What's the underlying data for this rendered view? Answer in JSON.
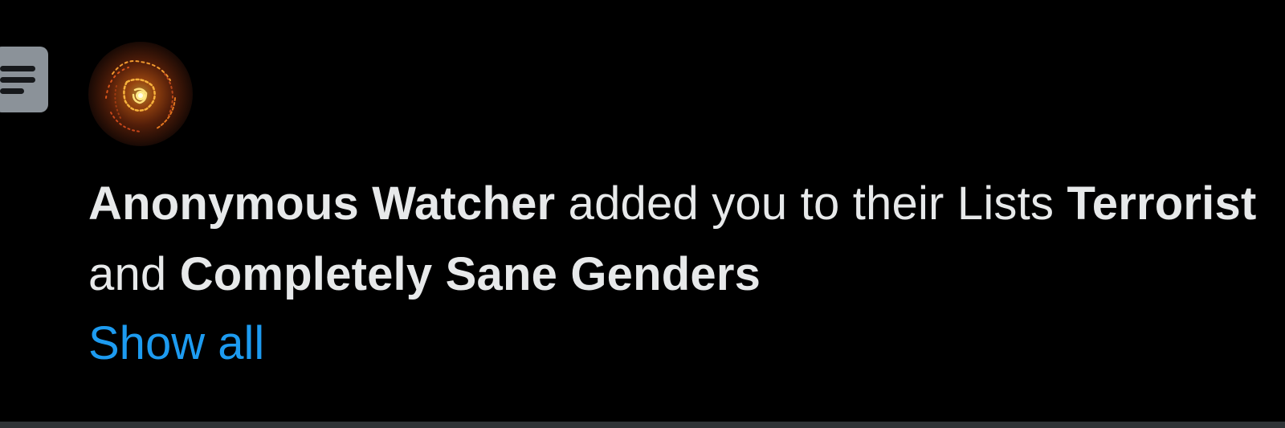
{
  "notification": {
    "icon": "list-icon",
    "avatar": {
      "alt": "avatar"
    },
    "actor_name": "Anonymous Watcher",
    "action_text": " added you to their Lists ",
    "list_one": "Terrorist",
    "conjunction": " and ",
    "list_two": "Completely Sane Genders",
    "show_all_label": "Show all"
  },
  "colors": {
    "background": "#000000",
    "text": "#e7e9ea",
    "link": "#1d9bf0",
    "icon_badge": "#8b9299",
    "divider": "#2f3336"
  }
}
